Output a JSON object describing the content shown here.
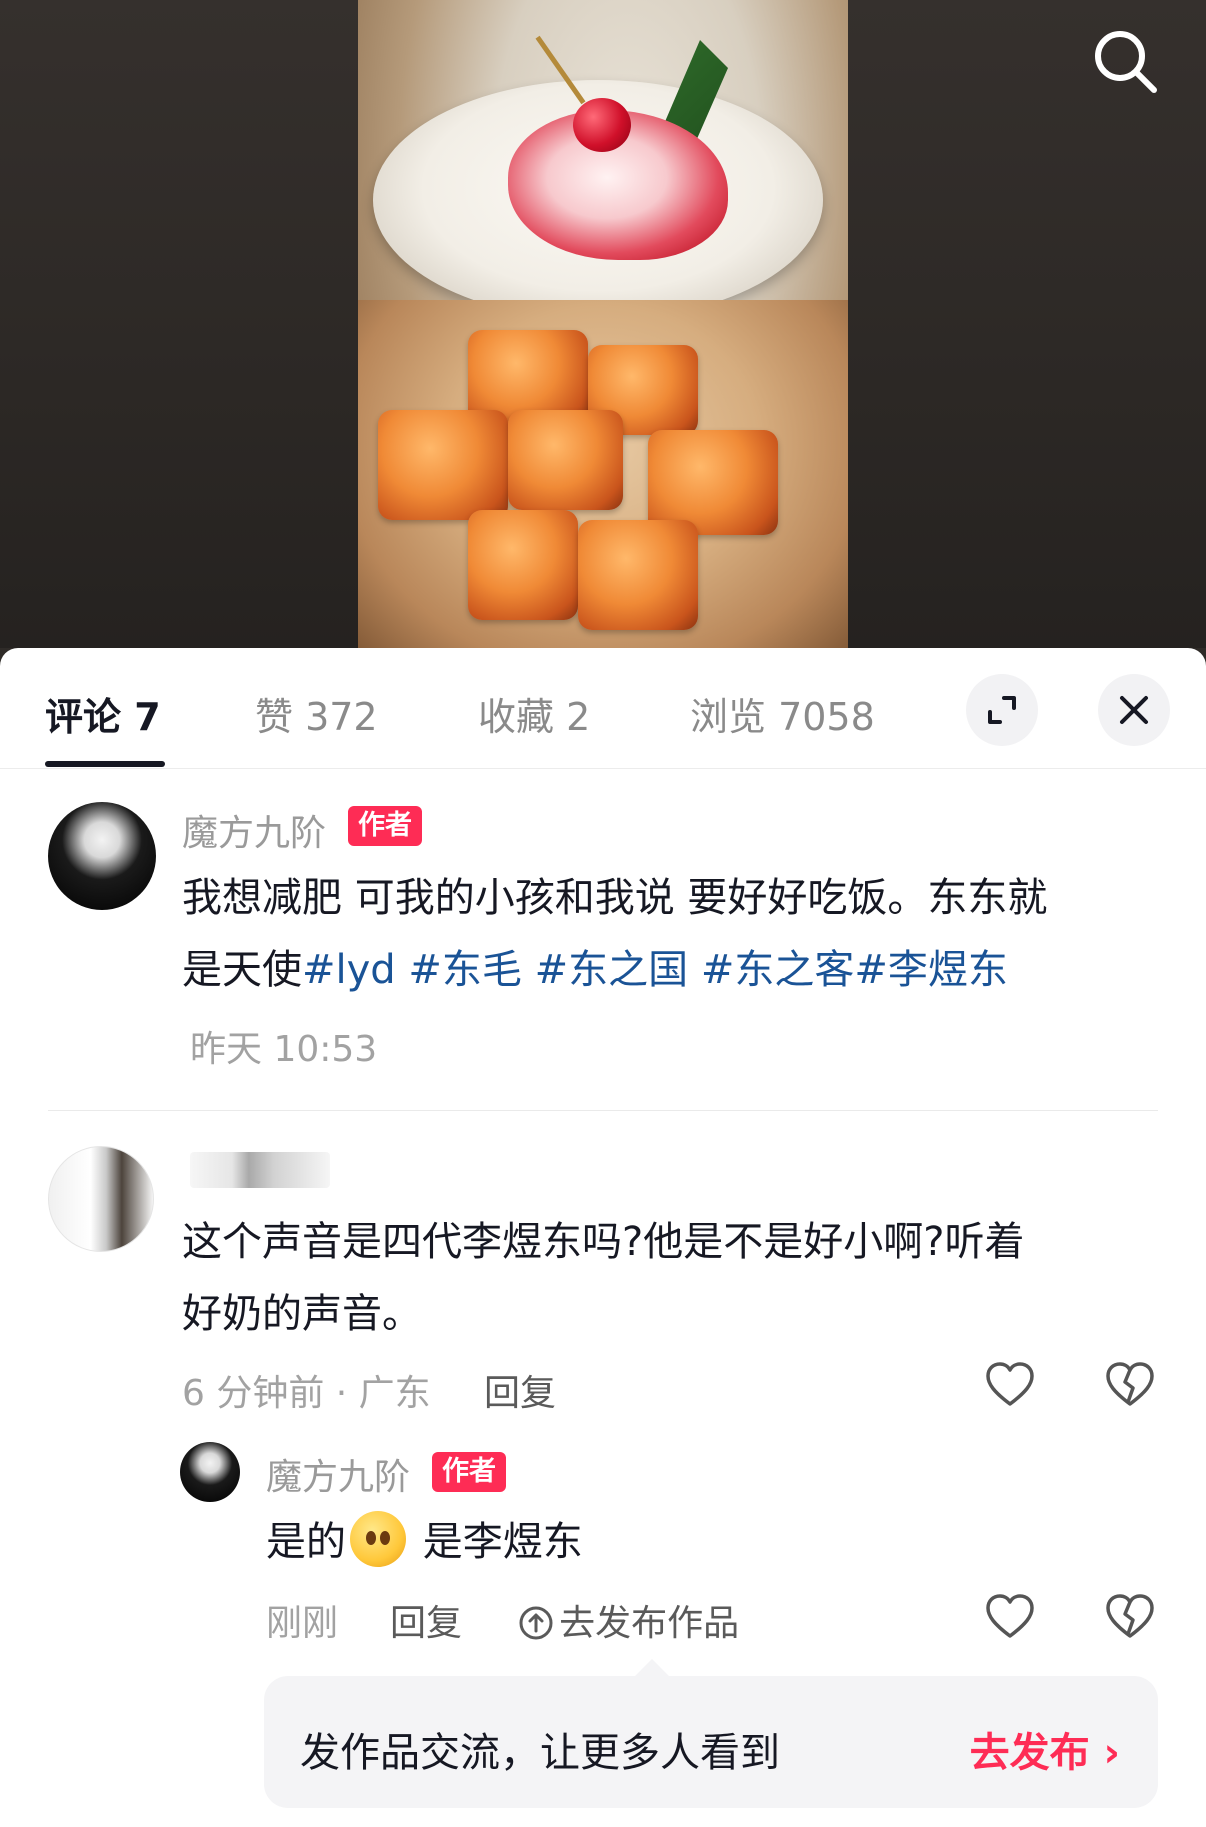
{
  "tabs": [
    {
      "label": "评论 7",
      "active": true
    },
    {
      "label": "赞 372",
      "active": false
    },
    {
      "label": "收藏 2",
      "active": false
    },
    {
      "label": "浏览 7058",
      "active": false
    }
  ],
  "header_icons": {
    "search": "search-icon",
    "expand": "expand-icon",
    "close": "close-icon"
  },
  "post": {
    "author": "魔方九阶",
    "badge": "作者",
    "text_line1": "我想减肥 可我的小孩和我说 要好好吃饭。东东就",
    "text_line2_plain": "是天使",
    "hashtags": [
      "#lyd",
      " #东毛",
      " #东之国",
      " #东之客",
      "#李煜东"
    ],
    "time": "昨天 10:53"
  },
  "comment": {
    "text_line1": "这个声音是四代李煜东吗?他是不是好小啊?听着",
    "text_line2": "好奶的声音。",
    "meta": "6 分钟前 · 广东",
    "reply_label": "回复",
    "icons": {
      "like": "heart-icon",
      "dislike": "broken-heart-icon"
    }
  },
  "reply": {
    "author": "魔方九阶",
    "badge": "作者",
    "text_before": "是的",
    "text_after": " 是李煜东",
    "emoji": "pleading-face-emoji",
    "time": "刚刚",
    "reply_label": "回复",
    "publish_label": "去发布作品",
    "icons": {
      "like": "heart-icon",
      "dislike": "broken-heart-icon",
      "upload": "upload-circle-icon"
    }
  },
  "toast": {
    "text": "发作品交流，让更多人看到",
    "cta": "去发布",
    "cta_arrow": "›"
  },
  "colors": {
    "accent": "#fe2c55",
    "hashtag": "#1a5396",
    "text": "#161823",
    "muted": "#9a9a9a"
  }
}
